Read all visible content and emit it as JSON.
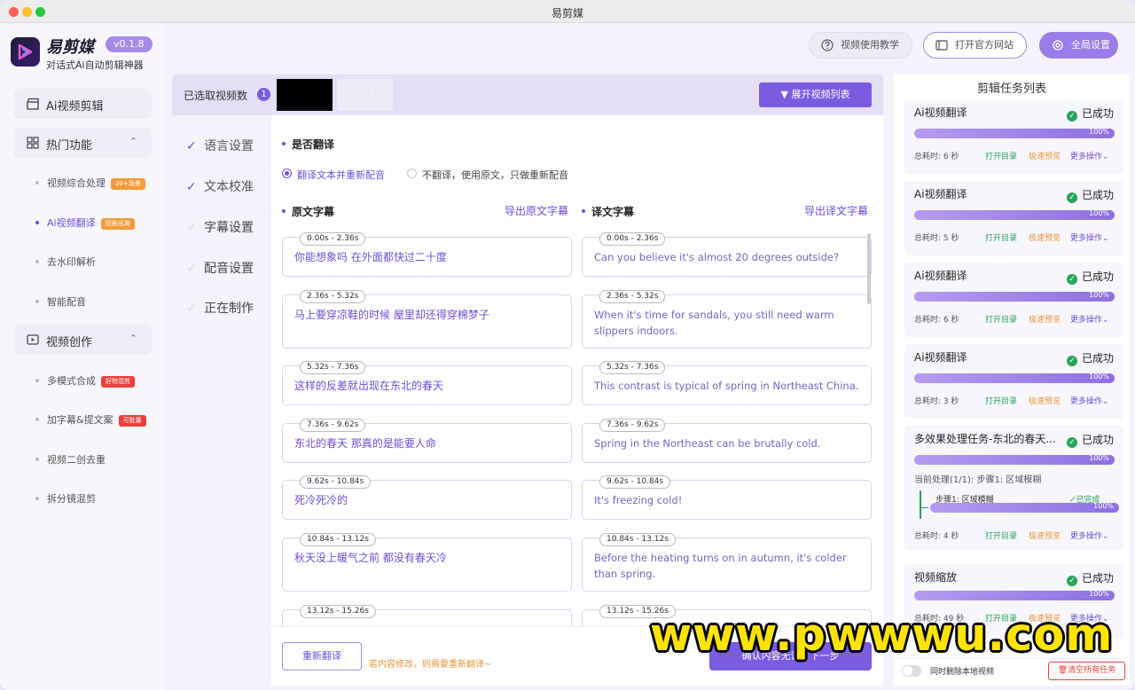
{
  "window": {
    "title": "易剪媒"
  },
  "app": {
    "name": "易剪媒",
    "version": "v0.1.8",
    "slogan": "对话式Ai自动剪辑神器"
  },
  "sidebar": {
    "ai_edit": "Ai视频剪辑",
    "hot": {
      "label": "热门功能",
      "items": [
        {
          "label": "视频综合处理",
          "badge": "30+场景"
        },
        {
          "label": "Ai视频翻译",
          "badge": "短剧出海"
        },
        {
          "label": "去水印解析",
          "badge": ""
        },
        {
          "label": "智能配音",
          "badge": ""
        }
      ]
    },
    "create": {
      "label": "视频创作",
      "items": [
        {
          "label": "多模式合成",
          "badge": "好物混剪"
        },
        {
          "label": "加字幕&提文案",
          "badge": "可批量"
        },
        {
          "label": "视频二创去重",
          "badge": ""
        },
        {
          "label": "拆分镜混剪",
          "badge": ""
        }
      ]
    }
  },
  "topbar": {
    "tutorial": "视频使用教学",
    "website": "打开官方网站",
    "settings": "全局设置"
  },
  "videos": {
    "label": "已选取视频数",
    "count": "1",
    "placeholder": "- - -",
    "expand": "展开视频列表"
  },
  "steps": [
    "语言设置",
    "文本校准",
    "字幕设置",
    "配音设置",
    "正在制作"
  ],
  "translate": {
    "question": "是否翻译",
    "opt_yes": "翻译文本并重新配音",
    "opt_no": "不翻译，使用原文，只做重新配音"
  },
  "subtitles": {
    "orig_title": "原文字幕",
    "orig_export": "导出原文字幕",
    "trans_title": "译文字幕",
    "trans_export": "导出译文字幕",
    "items": [
      {
        "time": "0.00s - 2.36s",
        "orig": "你能想象吗 在外面都快过二十度",
        "trans": "Can you believe it's almost 20 degrees outside?"
      },
      {
        "time": "2.36s - 5.32s",
        "orig": "马上要穿凉鞋的时候 屋里却还得穿棉梦子",
        "trans": "When it's time for sandals, you still need warm slippers indoors."
      },
      {
        "time": "5.32s - 7.36s",
        "orig": "这样的反差就出现在东北的春天",
        "trans": "This contrast is typical of spring in Northeast China."
      },
      {
        "time": "7.36s - 9.62s",
        "orig": "东北的春天 那真的是能要人命",
        "trans": "Spring in the Northeast can be brutally cold."
      },
      {
        "time": "9.62s - 10.84s",
        "orig": "死冷死冷的",
        "trans": "It's freezing cold!"
      },
      {
        "time": "10.84s - 13.12s",
        "orig": "秋天没上暖气之前 都没有春天冷",
        "trans": "Before the heating turns on in autumn, it's colder than spring."
      },
      {
        "time": "13.12s - 15.26s",
        "orig": "",
        "trans": ""
      }
    ]
  },
  "footer": {
    "retranslate": "重新翻译",
    "hint": "若内容修改，则需要重新翻译~",
    "confirm": "确认内容无误，下一步"
  },
  "tasks": {
    "title": "剪辑任务列表",
    "open_dir": "打开目录",
    "preview": "极速预览",
    "more": "更多操作",
    "list": [
      {
        "name": "Ai视频翻译",
        "status": "已成功",
        "progress": "100%",
        "time": "总耗时: 6 秒"
      },
      {
        "name": "Ai视频翻译",
        "status": "已成功",
        "progress": "100%",
        "time": "总耗时: 5 秒"
      },
      {
        "name": "Ai视频翻译",
        "status": "已成功",
        "progress": "100%",
        "time": "总耗时: 6 秒"
      },
      {
        "name": "Ai视频翻译",
        "status": "已成功",
        "progress": "100%",
        "time": "总耗时: 3 秒"
      },
      {
        "name": "多效果处理任务-东北的春天...",
        "status": "已成功",
        "progress": "100%",
        "time": "总耗时: 4 秒",
        "detail": "当前处理(1/1): 步骤1:  区域模糊",
        "substep": "步骤1:  区域模糊",
        "substep_status": "已完成",
        "substep_progress": "100%"
      },
      {
        "name": "视频缩放",
        "status": "已成功",
        "progress": "100%",
        "time": "总耗时: 49 秒"
      }
    ],
    "delete_local": "同时删除本地视频",
    "clear_all": "清空所有任务"
  },
  "watermark": "www.pwwwu.com"
}
